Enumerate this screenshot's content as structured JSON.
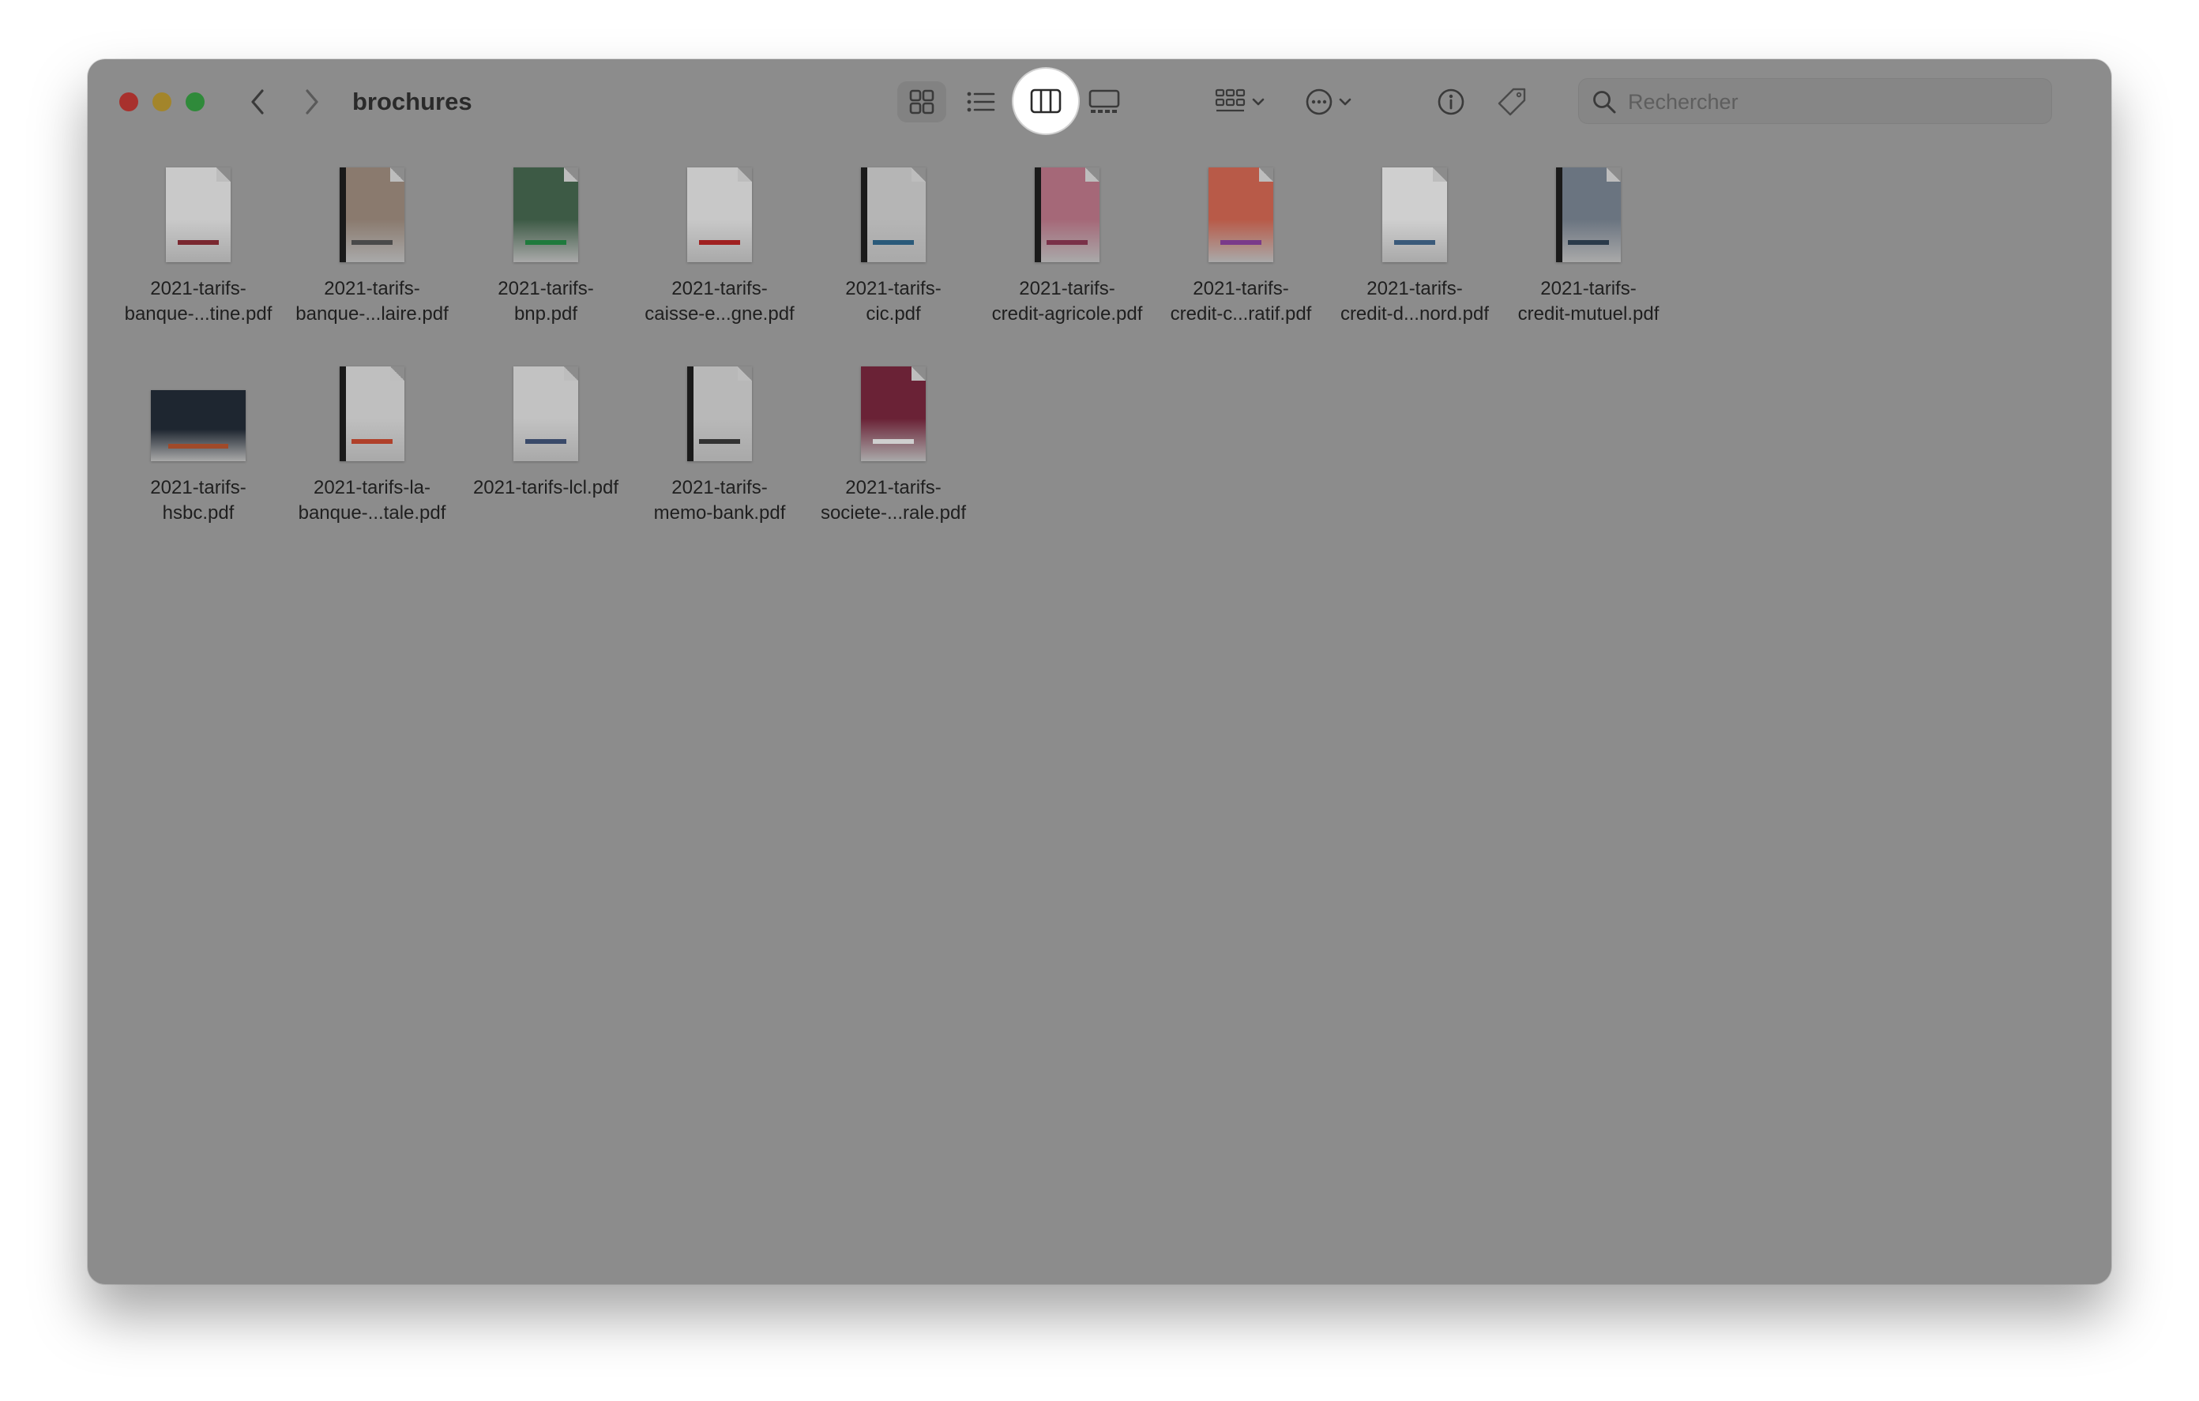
{
  "window": {
    "title": "brochures"
  },
  "toolbar": {
    "back_icon": "chevron-left-icon",
    "forward_icon": "chevron-right-icon",
    "views": [
      {
        "name": "icon-view",
        "icon": "grid-icon"
      },
      {
        "name": "list-view",
        "icon": "list-icon"
      },
      {
        "name": "column-view",
        "icon": "columns-icon"
      },
      {
        "name": "gallery-view",
        "icon": "gallery-icon"
      }
    ],
    "group_icon": "group-icon",
    "actions_icon": "ellipsis-circle-icon",
    "info_icon": "info-icon",
    "tag_icon": "tag-icon"
  },
  "search": {
    "placeholder": "Rechercher"
  },
  "files": [
    {
      "name": "2021-tarifs-\nbanque-...tine.pdf",
      "thumb_color": "#c9c9c9",
      "accent": "#7a2830"
    },
    {
      "name": "2021-tarifs-\nbanque-...laire.pdf",
      "thumb_color": "#8a7a6e",
      "accent": "#4a4a4a"
    },
    {
      "name": "2021-tarifs-\nbnp.pdf",
      "thumb_color": "#3d5a45",
      "accent": "#1f7a3d"
    },
    {
      "name": "2021-tarifs-\ncaisse-e...gne.pdf",
      "thumb_color": "#c8c8c8",
      "accent": "#a02020"
    },
    {
      "name": "2021-tarifs-\ncic.pdf",
      "thumb_color": "#b5b5b5",
      "accent": "#2a5a7a"
    },
    {
      "name": "2021-tarifs-\ncredit-agricole.pdf",
      "thumb_color": "#a56878",
      "accent": "#7a3048"
    },
    {
      "name": "2021-tarifs-\ncredit-c...ratif.pdf",
      "thumb_color": "#b85a48",
      "accent": "#7a3a8a"
    },
    {
      "name": "2021-tarifs-\ncredit-d...nord.pdf",
      "thumb_color": "#cfcfcf",
      "accent": "#3a5a7a"
    },
    {
      "name": "2021-tarifs-\ncredit-mutuel.pdf",
      "thumb_color": "#6a7480",
      "accent": "#2a3a4a"
    },
    {
      "name": "2021-tarifs-\nhsbc.pdf",
      "thumb_color": "#1e2630",
      "accent": "#a04a2a"
    },
    {
      "name": "2021-tarifs-la-\nbanque-...tale.pdf",
      "thumb_color": "#bfbfbf",
      "accent": "#b0402a"
    },
    {
      "name": "2021-tarifs-lcl.pdf",
      "thumb_color": "#c2c2c2",
      "accent": "#3a4a6a"
    },
    {
      "name": "2021-tarifs-\nmemo-bank.pdf",
      "thumb_color": "#b8b8b8",
      "accent": "#333333"
    },
    {
      "name": "2021-tarifs-\nsociete-...rale.pdf",
      "thumb_color": "#6a2236",
      "accent": "#cfcfcf"
    }
  ]
}
